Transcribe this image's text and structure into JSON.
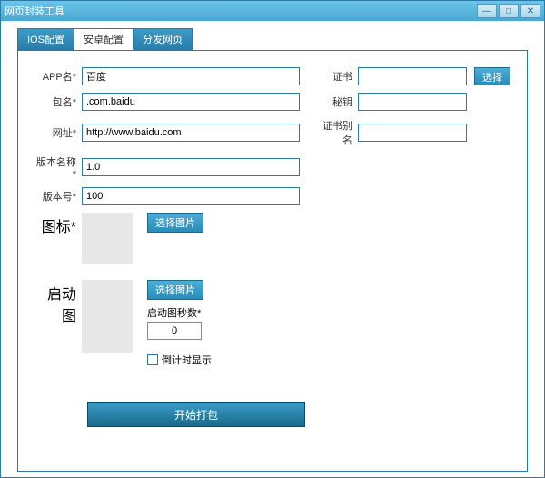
{
  "window": {
    "title": "网页封装工具"
  },
  "tabs": [
    {
      "label": "IOS配置",
      "active": false
    },
    {
      "label": "安卓配置",
      "active": true
    },
    {
      "label": "分发网页",
      "active": false
    }
  ],
  "form": {
    "appName": {
      "label": "APP名*",
      "value": "百度"
    },
    "cert": {
      "label": "证书",
      "value": ""
    },
    "certSelect": "选择",
    "packageName": {
      "label": "包名*",
      "value": ".com.baidu"
    },
    "secretKey": {
      "label": "秘钥",
      "value": ""
    },
    "url": {
      "label": "网址*",
      "value": "http://www.baidu.com"
    },
    "certAlias": {
      "label": "证书别名",
      "value": ""
    },
    "versionName": {
      "label": "版本名称*",
      "value": "1.0"
    },
    "versionCode": {
      "label": "版本号*",
      "value": "100"
    },
    "icon": {
      "label": "图标*",
      "selectBtn": "选择图片"
    },
    "splash": {
      "label": "启动图",
      "selectBtn": "选择图片",
      "secondsLabel": "启动图秒数*",
      "secondsValue": "0",
      "countdownLabel": "倒计时显示"
    }
  },
  "actions": {
    "build": "开始打包"
  }
}
